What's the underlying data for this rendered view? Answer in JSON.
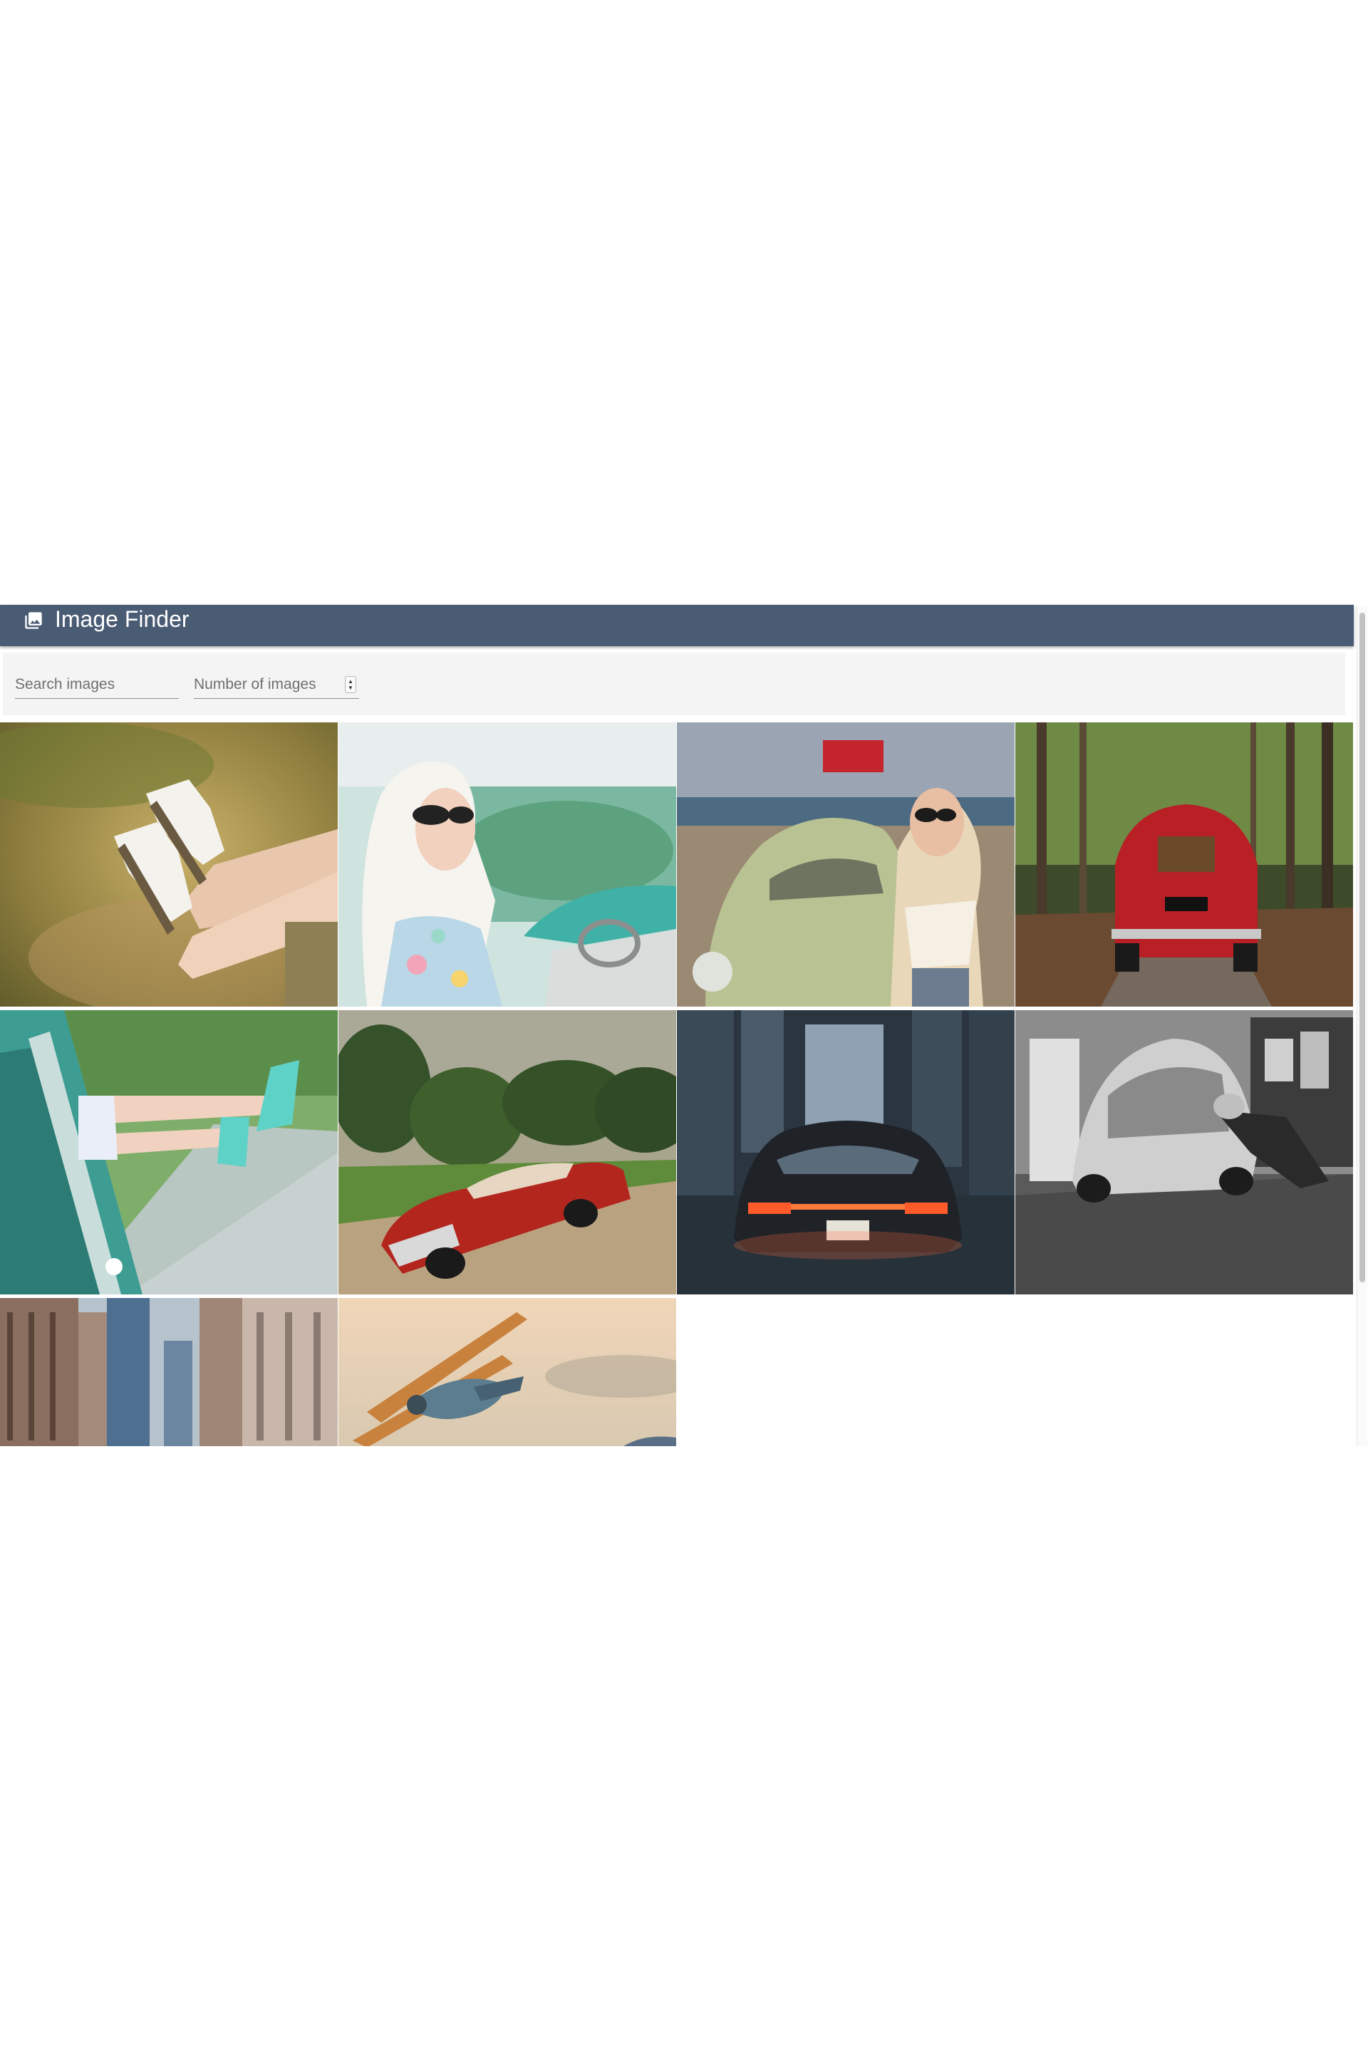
{
  "app": {
    "title": "Image Finder",
    "header_color": "#4a5b74"
  },
  "toolbar": {
    "search_placeholder": "Search images",
    "number_placeholder": "Number of images"
  },
  "icons": {
    "app": "photo-library-icon",
    "stepper": "up-down-stepper-icon"
  },
  "images": [
    {
      "subject": "legs-with-sneakers"
    },
    {
      "subject": "woman-in-headscarf-in-car"
    },
    {
      "subject": "woman-with-vw-beetle"
    },
    {
      "subject": "red-fiat-in-forest"
    },
    {
      "subject": "legs-with-turquoise-heels"
    },
    {
      "subject": "red-vintage-convertible"
    },
    {
      "subject": "porsche-at-night"
    },
    {
      "subject": "bw-beetle-mechanic"
    },
    {
      "subject": "city-buildings"
    },
    {
      "subject": "vintage-biplane"
    }
  ]
}
